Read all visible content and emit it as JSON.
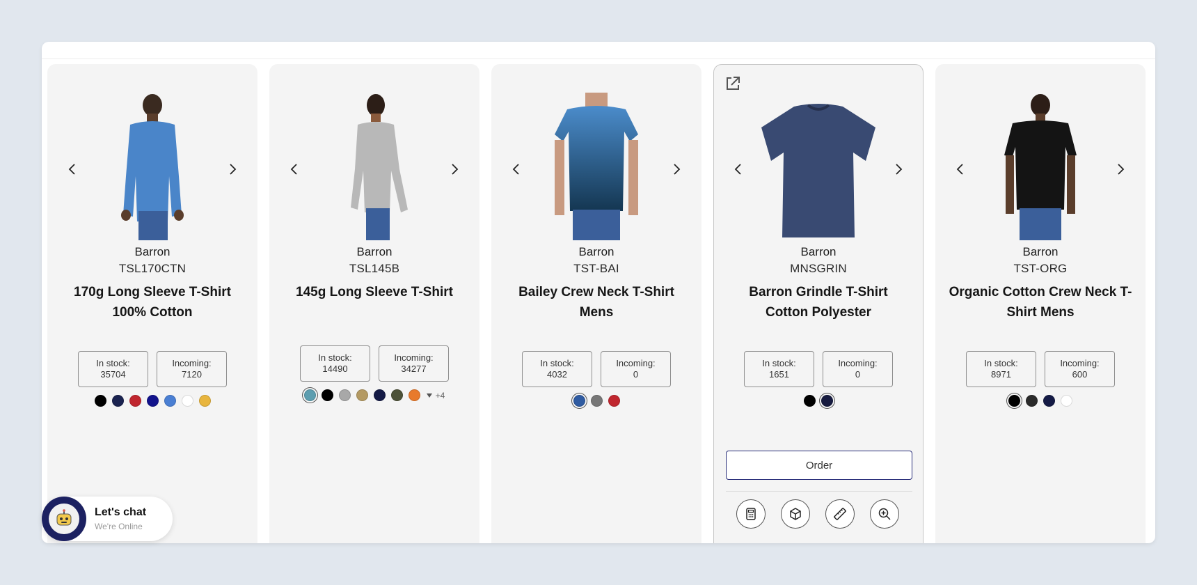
{
  "colors": {
    "accent": "#1c2161",
    "card_bg": "#f4f4f4",
    "page_bg": "#e1e7ee"
  },
  "products": [
    {
      "brand": "Barron",
      "sku": "TSL170CTN",
      "title": "170g Long Sleeve T-Shirt 100% Cotton",
      "in_stock_label": "In stock:",
      "in_stock": "35704",
      "incoming_label": "Incoming:",
      "incoming": "7120",
      "image": "model-blue-long-sleeve-tshirt",
      "swatches": [
        "#000000",
        "#1a2350",
        "#c0262e",
        "#12138c",
        "#4a7fd3",
        "#ffffff",
        "#e8b53e"
      ],
      "selected_swatch": -1,
      "more": ""
    },
    {
      "brand": "Barron",
      "sku": "TSL145B",
      "title": "145g Long Sleeve T-Shirt",
      "in_stock_label": "In stock:",
      "in_stock": "14490",
      "incoming_label": "Incoming:",
      "incoming": "34277",
      "image": "model-grey-long-sleeve-tshirt",
      "swatches": [
        "#5d9eb0",
        "#000000",
        "#a8a8a8",
        "#b49a63",
        "#141a45",
        "#4d5238",
        "#e87a2c"
      ],
      "selected_swatch": 0,
      "more": "+4"
    },
    {
      "brand": "Barron",
      "sku": "TST-BAI",
      "title": "Bailey Crew Neck T-Shirt Mens",
      "in_stock_label": "In stock:",
      "in_stock": "4032",
      "incoming_label": "Incoming:",
      "incoming": "0",
      "image": "model-ombre-blue-tshirt",
      "swatches": [
        "#2f5ba1",
        "#777777",
        "#c0262e"
      ],
      "selected_swatch": 0,
      "more": ""
    },
    {
      "brand": "Barron",
      "sku": "MNSGRIN",
      "title": "Barron Grindle T-Shirt Cotton Polyester",
      "in_stock_label": "In stock:",
      "in_stock": "1651",
      "incoming_label": "Incoming:",
      "incoming": "0",
      "image": "navy-grindle-tshirt-flat",
      "swatches": [
        "#000000",
        "#161a3f"
      ],
      "selected_swatch": 1,
      "more": "",
      "order_label": "Order"
    },
    {
      "brand": "Barron",
      "sku": "TST-ORG",
      "title": "Organic Cotton Crew Neck T-Shirt Mens",
      "in_stock_label": "In stock:",
      "in_stock": "8971",
      "incoming_label": "Incoming:",
      "incoming": "600",
      "image": "model-black-tshirt",
      "swatches": [
        "#000000",
        "#2a2a2a",
        "#141a45",
        "#ffffff"
      ],
      "selected_swatch": 0,
      "more": ""
    }
  ],
  "tools": [
    "calculator-icon",
    "box-icon",
    "ruler-icon",
    "zoom-in-icon"
  ],
  "chat": {
    "title": "Let's chat",
    "subtitle": "We're Online"
  }
}
